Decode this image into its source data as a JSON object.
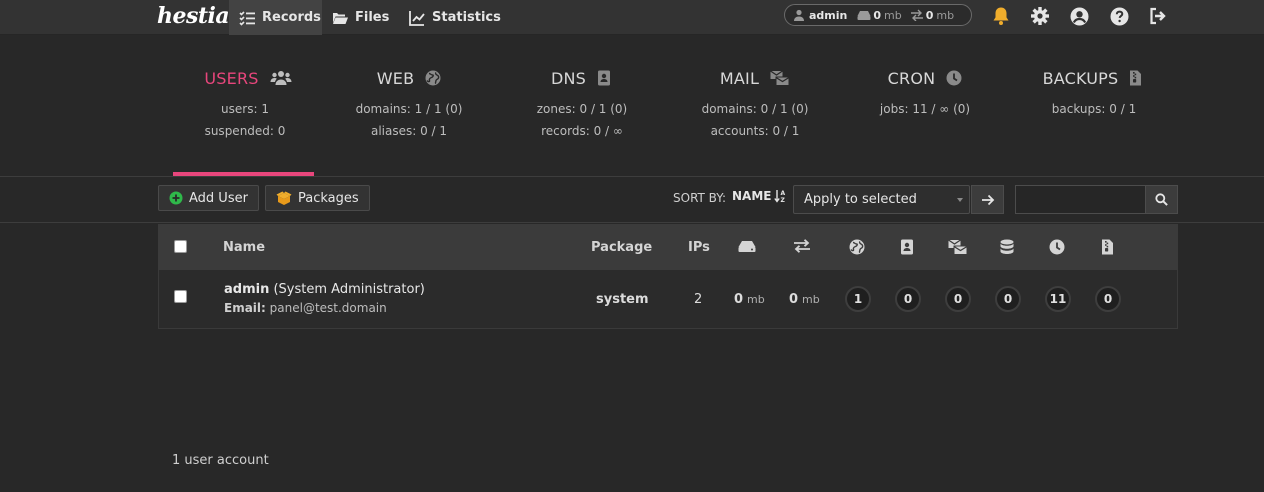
{
  "topbar": {
    "logo": "hestia",
    "nav": [
      {
        "label": "Records",
        "icon": "list-check-icon"
      },
      {
        "label": "Files",
        "icon": "folder-open-icon"
      },
      {
        "label": "Statistics",
        "icon": "chart-line-icon"
      }
    ],
    "user": {
      "name": "admin",
      "disk_value": "0",
      "disk_unit": "mb",
      "bandwidth_value": "0",
      "bandwidth_unit": "mb"
    },
    "icons": [
      "bell-icon",
      "gear-icon",
      "user-circle-icon",
      "help-icon",
      "logout-icon"
    ],
    "bell_color": "#f0ad2c"
  },
  "stats": [
    {
      "title": "USERS",
      "icon": "users-icon",
      "lines": [
        "users: 1",
        "suspended: 0"
      ],
      "active": true
    },
    {
      "title": "WEB",
      "icon": "globe-icon",
      "lines": [
        "domains: 1 / 1 (0)",
        "aliases: 0 / 1"
      ]
    },
    {
      "title": "DNS",
      "icon": "address-book-icon",
      "lines": [
        "zones: 0 / 1 (0)",
        "records: 0 / ∞"
      ]
    },
    {
      "title": "MAIL",
      "icon": "mail-bulk-icon",
      "lines": [
        "domains: 0 / 1 (0)",
        "accounts: 0 / 1"
      ]
    },
    {
      "title": "CRON",
      "icon": "clock-icon",
      "lines": [
        "jobs: 11 / ∞ (0)"
      ]
    },
    {
      "title": "BACKUPS",
      "icon": "file-archive-icon",
      "lines": [
        "backups: 0 / 1"
      ]
    }
  ],
  "accent_color": "#e8467c",
  "toolbar": {
    "add_user_label": "Add User",
    "packages_label": "Packages",
    "sort_by_label": "SORT BY:",
    "sort_value": "NAME",
    "apply_select_value": "Apply to selected",
    "search_placeholder": ""
  },
  "table": {
    "headers": {
      "name": "Name",
      "package": "Package",
      "ips": "IPs"
    },
    "header_icons": [
      "hard-drive-icon",
      "exchange-icon",
      "globe-icon",
      "address-book-icon",
      "mail-bulk-icon",
      "database-icon",
      "clock-icon",
      "file-archive-icon"
    ],
    "rows": [
      {
        "username": "admin",
        "fullname": "(System Administrator)",
        "email_label": "Email:",
        "email": "panel@test.domain",
        "package": "system",
        "ips": "2",
        "disk_value": "0",
        "disk_unit": "mb",
        "bandwidth_value": "0",
        "bandwidth_unit": "mb",
        "web": "1",
        "dns": "0",
        "mail": "0",
        "db": "0",
        "cron": "11",
        "backups": "0"
      }
    ]
  },
  "footer": {
    "count_text": "1 user account"
  }
}
